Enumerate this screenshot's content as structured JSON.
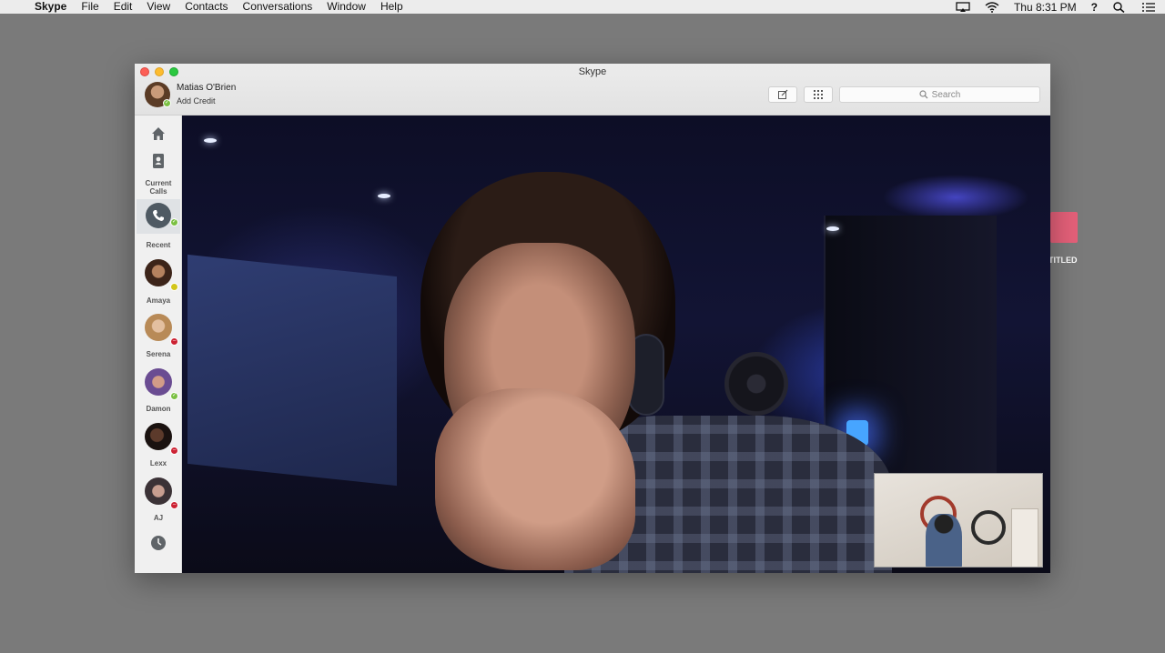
{
  "menubar": {
    "app_name": "Skype",
    "menus": [
      "File",
      "Edit",
      "View",
      "Contacts",
      "Conversations",
      "Window",
      "Help"
    ],
    "clock": "Thu 8:31 PM",
    "help_icon_label": "?",
    "icons": [
      "airplay-icon",
      "wifi-icon",
      "spotlight-search-icon",
      "notification-list-icon"
    ]
  },
  "desktop": {
    "item_label": "TITLED",
    "item_color": "#e46079"
  },
  "window": {
    "title": "Skype",
    "profile": {
      "name": "Matias O'Brien",
      "subtitle": "Add Credit",
      "status": "online"
    },
    "toolbar": {
      "compose_icon": "compose-icon",
      "dialpad_icon": "dialpad-icon"
    },
    "search": {
      "placeholder": "Search"
    }
  },
  "sidebar": {
    "home_icon": "home-icon",
    "contacts_icon": "contacts-book-icon",
    "current_calls_label": "Current Calls",
    "recent_label": "Recent",
    "contacts": [
      {
        "name": "Amaya",
        "status": "away"
      },
      {
        "name": "Serena",
        "status": "busy"
      },
      {
        "name": "Damon",
        "status": "online"
      },
      {
        "name": "Lexx",
        "status": "busy"
      },
      {
        "name": "AJ",
        "status": "busy"
      }
    ],
    "history_icon": "clock-icon"
  },
  "colors": {
    "online": "#7bc043",
    "away": "#d2c61a",
    "busy": "#cc2233",
    "accent_call": "#4f5a63"
  }
}
